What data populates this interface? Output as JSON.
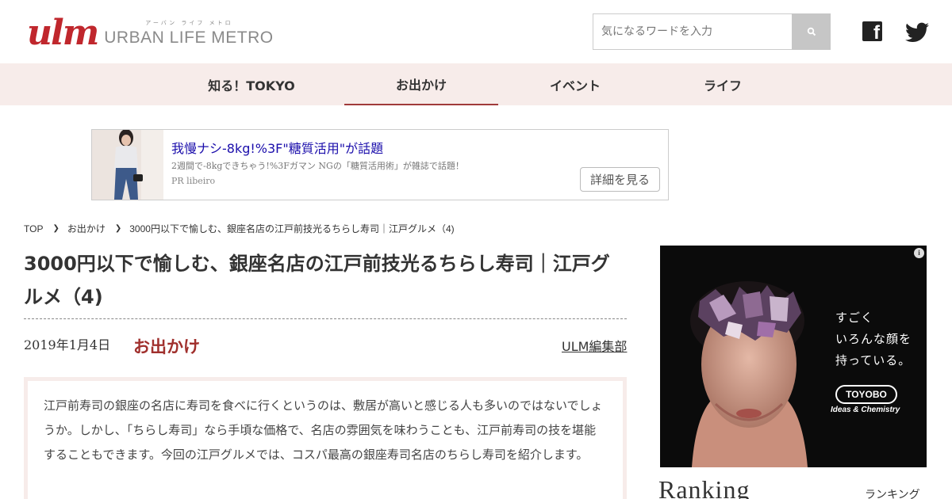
{
  "header": {
    "logo_mark": "ulm",
    "logo_ruby": "アーバン ライフ メトロ",
    "logo_name": "URBAN LIFE METRO",
    "search_placeholder": "気になるワードを入力",
    "social": [
      "facebook-icon",
      "twitter-icon"
    ],
    "facebook_glyph": "f"
  },
  "nav": {
    "items": [
      {
        "label": "知る！TOKYO",
        "active": false
      },
      {
        "label": "お出かけ",
        "active": true
      },
      {
        "label": "イベント",
        "active": false
      },
      {
        "label": "ライフ",
        "active": false
      }
    ]
  },
  "ad": {
    "title": "我慢ナシ-8kg!%3F\"糖質活用\"が話題",
    "description": "2週間で-8kgできちゃう!%3Fガマン NGの「糖質活用術」が雑誌で話題！",
    "pr": "PR  libeiro",
    "button": "詳細を見る"
  },
  "breadcrumb": [
    "TOP",
    "お出かけ",
    "3000円以下で愉しむ、銀座名店の江戸前技光るちらし寿司｜江戸グルメ（4)"
  ],
  "article": {
    "title": "3000円以下で愉しむ、銀座名店の江戸前技光るちらし寿司｜江戸グルメ（4)",
    "date": "2019年1月4日",
    "category": "お出かけ",
    "author": "ULM編集部",
    "lead": "江戸前寿司の銀座の名店に寿司を食べに行くというのは、敷居が高いと感じる人も多いのではないでしょうか。しかし、「ちらし寿司」なら手頃な価格で、名店の雰囲気を味わうことも、江戸前寿司の技を堪能することもできます。今回の江戸グルメでは、コスパ最高の銀座寿司名店のちらし寿司を紹介します。"
  },
  "side_ad": {
    "info_glyph": "i",
    "copy_line1": "すごく",
    "copy_line2": "いろんな顔を",
    "copy_line3": "持っている。",
    "brand": "TOYOBO",
    "tagline": "Ideas & Chemistry"
  },
  "ranking": {
    "title_en": "Ranking",
    "title_ja": "ランキング"
  },
  "colors": {
    "brand_red": "#c0272d",
    "nav_bg": "#f7ecea",
    "category_red": "#a0302d",
    "ad_link": "#1a0dab"
  }
}
